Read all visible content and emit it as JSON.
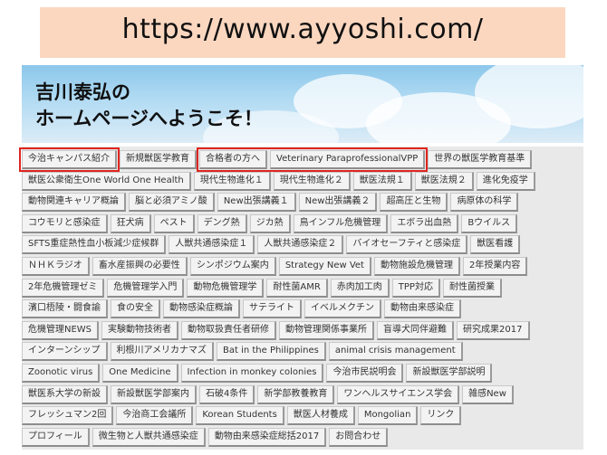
{
  "url_banner": {
    "text": "https://www.ayyoshi.com/"
  },
  "hero": {
    "title_line1": "吉川泰弘の",
    "title_line2": "ホームページへようこそ！"
  },
  "menu": {
    "rows": [
      [
        "今治キャンパス紹介",
        "新規獣医学教育",
        "合格者の方へ",
        "Veterinary ParaprofessionalVPP",
        "世界の獣医学教育基準"
      ],
      [
        "獣医公衆衛生One World One Health",
        "現代生物進化１",
        "現代生物進化２",
        "獣医法規１",
        "獣医法規２",
        "進化免疫学"
      ],
      [
        "動物関連キャリア概論",
        "脳と必須アミノ酸",
        "New出張講義１",
        "New出張講義２",
        "超高圧と生物",
        "病原体の科学"
      ],
      [
        "コウモリと感染症",
        "狂犬病",
        "ペスト",
        "デング熱",
        "ジカ熱",
        "鳥インフル危機管理",
        "エボラ出血熱",
        "Bウイルス"
      ],
      [
        "SFTS重症熱性血小板減少症候群",
        "人獣共通感染症１",
        "人獣共通感染症２",
        "バイオセーフティと感染症",
        "獣医看護"
      ],
      [
        "ＮＨＫラジオ",
        "畜水産振興の必要性",
        "シンポジウム案内",
        "Strategy New Vet",
        "動物施設危機管理",
        "2年授業内容"
      ],
      [
        "2年危機管理ゼミ",
        "危機管理学入門",
        "動物危機管理学",
        "耐性菌AMR",
        "赤肉加工肉",
        "TPP対応",
        "耐性菌授業"
      ],
      [
        "濱口梧陵・闘食諭",
        "食の安全",
        "動物感染症概論",
        "サテライト",
        "イベルメクチン",
        "動物由来感染症"
      ],
      [
        "危機管理NEWS",
        "実験動物技術者",
        "動物取扱責任者研修",
        "動物管理関係事業所",
        "盲導犬同伴避難",
        "研究成果2017"
      ],
      [
        "インターンシップ",
        "利根川アメリカナマズ",
        "Bat in the Philippines",
        "animal crisis management"
      ],
      [
        "Zoonotic virus",
        "One Medicine",
        "Infection in monkey colonies",
        "今治市民説明会",
        "新設獣医学部説明"
      ],
      [
        "獣医系大学の新設",
        "新設獣医学部案内",
        "石破4条件",
        "新学部教養教育",
        "ワンヘルスサイエンス学会",
        "雑感New"
      ],
      [
        "フレッシュマン2回",
        "今治商工会議所",
        "Korean Students",
        "獣医人材養成",
        "Mongolian",
        "リンク"
      ],
      [
        "プロフィール",
        "微生物と人獣共通感染症",
        "動物由来感染症総括2017",
        "お問合わせ"
      ]
    ]
  }
}
